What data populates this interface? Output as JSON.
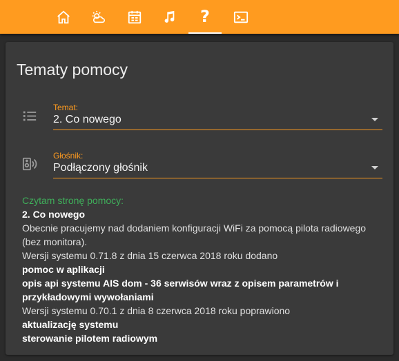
{
  "nav": {
    "tabs": [
      {
        "icon": "home-icon"
      },
      {
        "icon": "weather-icon"
      },
      {
        "icon": "calendar-icon"
      },
      {
        "icon": "music-note-icon"
      },
      {
        "icon": "help-question-icon",
        "label": "?",
        "active": true
      },
      {
        "icon": "console-icon"
      }
    ],
    "accent_color": "#ff9b1f"
  },
  "card": {
    "title": "Tematy pomocy",
    "topic": {
      "label": "Temat:",
      "value": "2. Co nowego",
      "icon": "list-icon"
    },
    "speaker": {
      "label": "Głośnik:",
      "value": "Podłączony głośnik",
      "icon": "speaker-icon"
    },
    "help": {
      "reading_label": "Czytam stronę pomocy:",
      "lines": [
        {
          "text": "2. Co nowego",
          "bold": true
        },
        {
          "text": "Obecnie pracujemy nad dodaniem konfiguracji WiFi za pomocą pilota radiowego (bez monitora).",
          "bold": false
        },
        {
          "text": "Wersji systemu 0.71.8 z dnia 15 czerwca 2018 roku dodano",
          "bold": false
        },
        {
          "text": "pomoc w aplikacji",
          "bold": true
        },
        {
          "text": "opis api systemu AIS dom - 36 serwisów wraz z opisem parametrów i przykładowymi wywołaniami",
          "bold": true
        },
        {
          "text": "Wersji systemu 0.70.1 z dnia 8 czerwca 2018 roku poprawiono",
          "bold": false
        },
        {
          "text": "aktualizację systemu",
          "bold": true
        },
        {
          "text": "sterowanie pilotem radiowym",
          "bold": true
        }
      ]
    }
  }
}
